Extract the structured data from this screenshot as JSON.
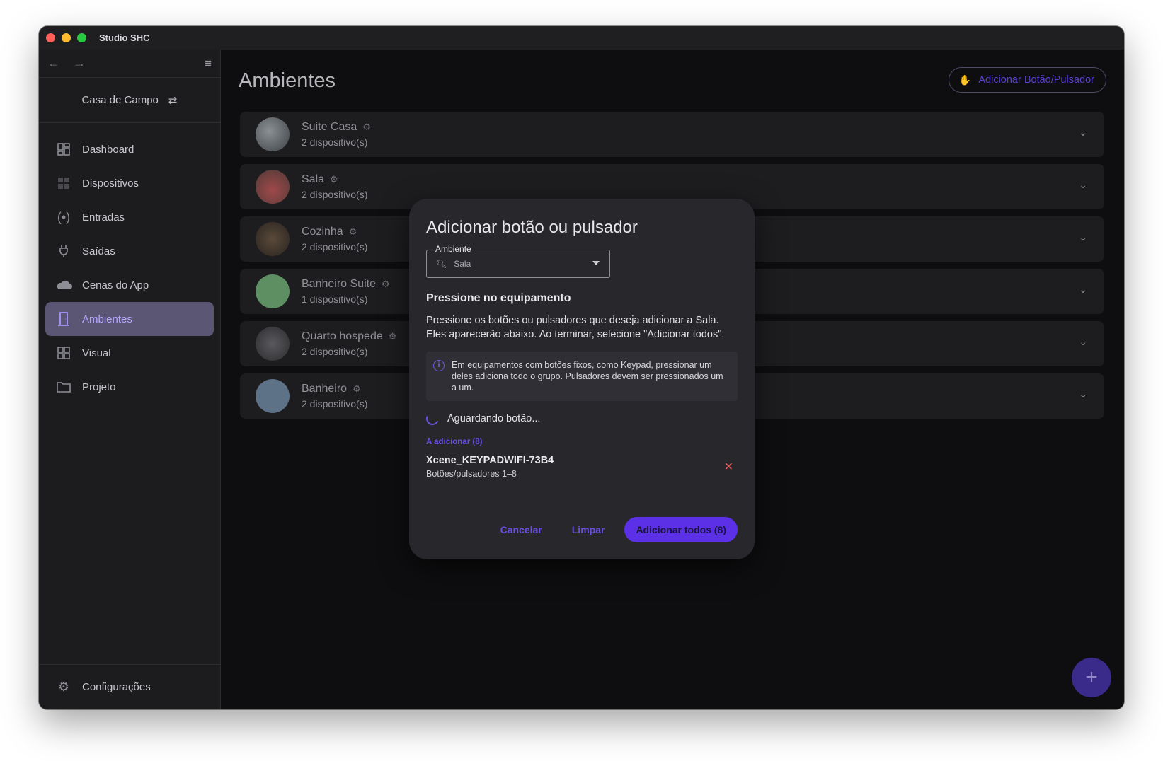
{
  "window": {
    "title": "Studio SHC"
  },
  "sidebar": {
    "back_icon": "arrow-left-icon",
    "forward_icon": "arrow-right-icon",
    "collapse_icon": "menu-collapse-icon",
    "project_name": "Casa de Campo",
    "items": [
      {
        "label": "Dashboard",
        "icon": "dashboard-icon",
        "active": false
      },
      {
        "label": "Dispositivos",
        "icon": "devices-icon",
        "active": false
      },
      {
        "label": "Entradas",
        "icon": "broadcast-icon",
        "active": false
      },
      {
        "label": "Saídas",
        "icon": "plug-icon",
        "active": false
      },
      {
        "label": "Cenas do App",
        "icon": "cloud-icon",
        "active": false
      },
      {
        "label": "Ambientes",
        "icon": "door-icon",
        "active": true
      },
      {
        "label": "Visual",
        "icon": "grid-icon",
        "active": false
      },
      {
        "label": "Projeto",
        "icon": "folder-icon",
        "active": false
      }
    ],
    "settings_label": "Configurações"
  },
  "main": {
    "title": "Ambientes",
    "add_button_label": "Adicionar Botão/Pulsador",
    "rooms": [
      {
        "name": "Suite Casa",
        "count": "2 dispositivo(s)",
        "color": "#5f6468"
      },
      {
        "name": "Sala",
        "count": "2 dispositivo(s)",
        "color": "#6a4c48"
      },
      {
        "name": "Cozinha",
        "count": "2 dispositivo(s)",
        "color": "#3c3530"
      },
      {
        "name": "Banheiro Suite",
        "count": "1 dispositivo(s)",
        "color": "#5e8f63"
      },
      {
        "name": "Quarto hospede",
        "count": "2 dispositivo(s)",
        "color": "#3a3a3d"
      },
      {
        "name": "Banheiro",
        "count": "2 dispositivo(s)",
        "color": "#5d7286"
      }
    ],
    "fab_label": "+"
  },
  "dialog": {
    "title": "Adicionar botão ou pulsador",
    "field_label": "Ambiente",
    "field_value": "Sala",
    "section_title": "Pressione no equipamento",
    "description": "Pressione os botões ou pulsadores que deseja adicionar a Sala. Eles aparecerão abaixo. Ao terminar, selecione \"Adicionar todos\".",
    "info": "Em equipamentos com botões fixos, como Keypad, pressionar um deles adiciona todo o grupo. Pulsadores devem ser pressionados um a um.",
    "waiting": "Aguardando botão...",
    "to_add_label": "A adicionar (8)",
    "item_name": "Xcene_KEYPADWIFI-73B4",
    "item_sub": "Botões/pulsadores 1–8",
    "cancel": "Cancelar",
    "clear": "Limpar",
    "add_all": "Adicionar todos (8)"
  }
}
